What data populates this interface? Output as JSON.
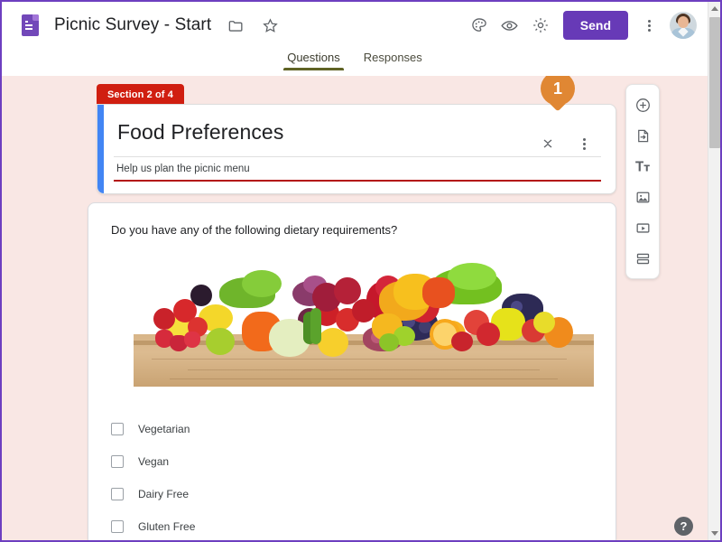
{
  "window": {
    "border_color": "#6d3fc0"
  },
  "appbar": {
    "logo_icon": "google-forms-icon",
    "doc_title": "Picnic Survey - Start",
    "folder_icon": "folder-move-icon",
    "star_icon": "star-icon",
    "theme_icon": "palette-icon",
    "preview_icon": "eye-preview-icon",
    "settings_icon": "gear-settings-icon",
    "send_label": "Send",
    "more_icon": "more-vert-icon",
    "avatar_name": "account-avatar",
    "send_color": "#673ab7"
  },
  "tabs": {
    "items": [
      {
        "label": "Questions",
        "active": true
      },
      {
        "label": "Responses",
        "active": false
      }
    ],
    "active_underline_color": "#5f6325"
  },
  "canvas": {
    "background_color": "#f9e7e4"
  },
  "section": {
    "tab_label": "Section 2 of 4",
    "tab_color": "#d01e10",
    "accent_color": "#4285f4",
    "title": "Food Preferences",
    "description": "Help us plan the picnic menu",
    "description_underline_color": "#b31412",
    "collapse_icon": "collapse-chevrons-icon",
    "more_icon": "more-vert-icon"
  },
  "question": {
    "text": "Do you have any of the following dietary requirements?",
    "image_alt": "fruits-and-vegetables-on-wooden-table",
    "options": [
      {
        "label": "Vegetarian",
        "checked": false
      },
      {
        "label": "Vegan",
        "checked": false
      },
      {
        "label": "Dairy Free",
        "checked": false
      },
      {
        "label": "Gluten Free",
        "checked": false
      }
    ]
  },
  "side_toolbar": {
    "buttons": [
      {
        "icon": "add-question-icon",
        "name": "add-question-button"
      },
      {
        "icon": "import-questions-icon",
        "name": "import-questions-button"
      },
      {
        "icon": "add-title-description-icon",
        "name": "add-title-button"
      },
      {
        "icon": "add-image-icon",
        "name": "add-image-button"
      },
      {
        "icon": "add-video-icon",
        "name": "add-video-button"
      },
      {
        "icon": "add-section-icon",
        "name": "add-section-button"
      }
    ]
  },
  "annotations": [
    {
      "number": "1",
      "color": "#e08733",
      "target": "section-collapse-icon"
    }
  ],
  "help": {
    "label": "?"
  },
  "scrollbar": {
    "up_arrow": "scroll-up-arrow-icon",
    "down_arrow": "scroll-down-arrow-icon"
  }
}
